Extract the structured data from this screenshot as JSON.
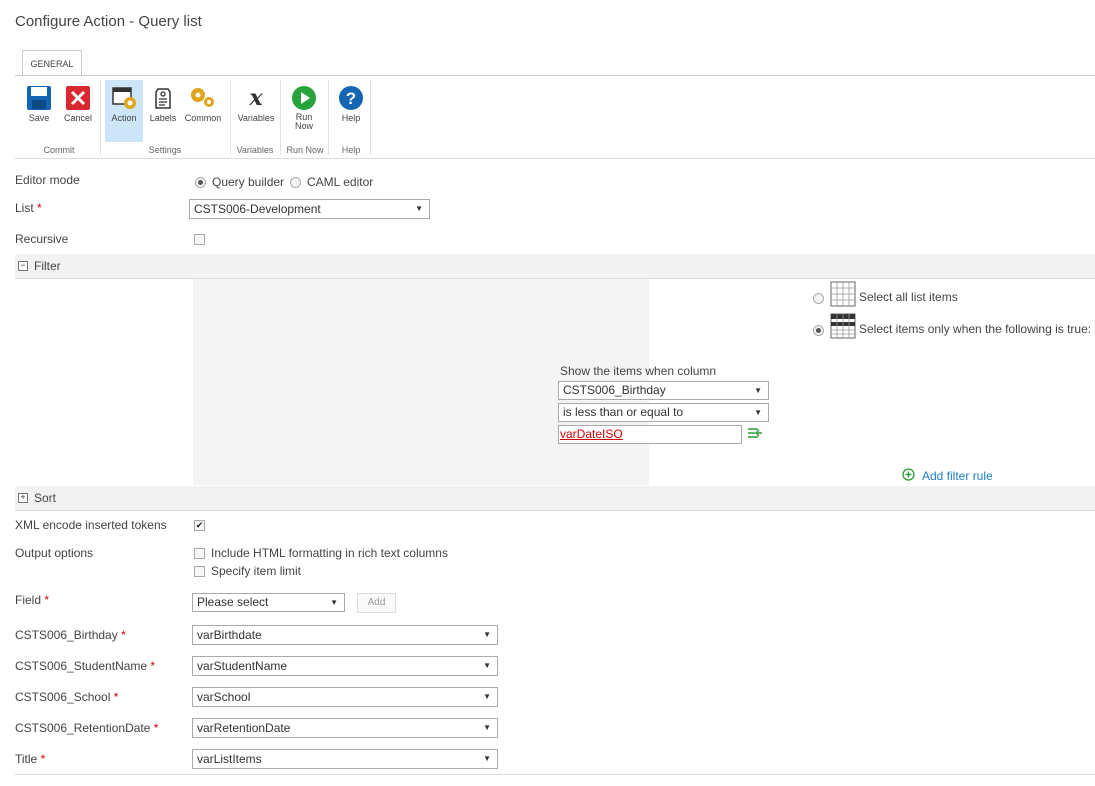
{
  "page": {
    "title": "Configure Action - Query list"
  },
  "ribbon": {
    "tab": "GENERAL",
    "buttons": {
      "save": "Save",
      "cancel": "Cancel",
      "action": "Action",
      "labels": "Labels",
      "common": "Common",
      "variables": "Variables",
      "run_now_1": "Run",
      "run_now_2": "Now",
      "help": "Help"
    },
    "groups": {
      "commit": "Commit",
      "settings": "Settings",
      "variables": "Variables",
      "run_now": "Run Now",
      "help": "Help"
    }
  },
  "form": {
    "editor_mode": {
      "label": "Editor mode",
      "option_query": "Query builder",
      "option_caml": "CAML editor",
      "selected": "Query builder"
    },
    "list": {
      "label": "List",
      "value": "CSTS006-Development"
    },
    "recursive": {
      "label": "Recursive",
      "checked": false
    },
    "filter": {
      "label": "Filter",
      "select_all": "Select all list items",
      "select_when": "Select items only when the following is true:",
      "show_items_label": "Show the items when column",
      "column": "CSTS006_Birthday",
      "operator": "is less than or equal to",
      "value_token": "varDateISO",
      "add_rule": "Add filter rule"
    },
    "sort": {
      "label": "Sort"
    },
    "xml_encode": {
      "label": "XML encode inserted tokens",
      "checked": true
    },
    "output_options": {
      "label": "Output options",
      "include_html": "Include HTML formatting in rich text columns",
      "item_limit": "Specify item limit"
    },
    "field": {
      "label": "Field",
      "value": "Please select",
      "add": "Add"
    },
    "mappings": [
      {
        "label": "CSTS006_Birthday",
        "value": "varBirthdate"
      },
      {
        "label": "CSTS006_StudentName",
        "value": "varStudentName"
      },
      {
        "label": "CSTS006_School",
        "value": "varSchool"
      },
      {
        "label": "CSTS006_RetentionDate",
        "value": "varRetentionDate"
      },
      {
        "label": "Title",
        "value": "varListItems"
      }
    ],
    "required_mark": "*"
  },
  "colors": {
    "accent": "#1e7ec8",
    "active_tab": "#cde6f7",
    "token": "#cc0000",
    "add_rule_green": "#2e9b3c"
  }
}
